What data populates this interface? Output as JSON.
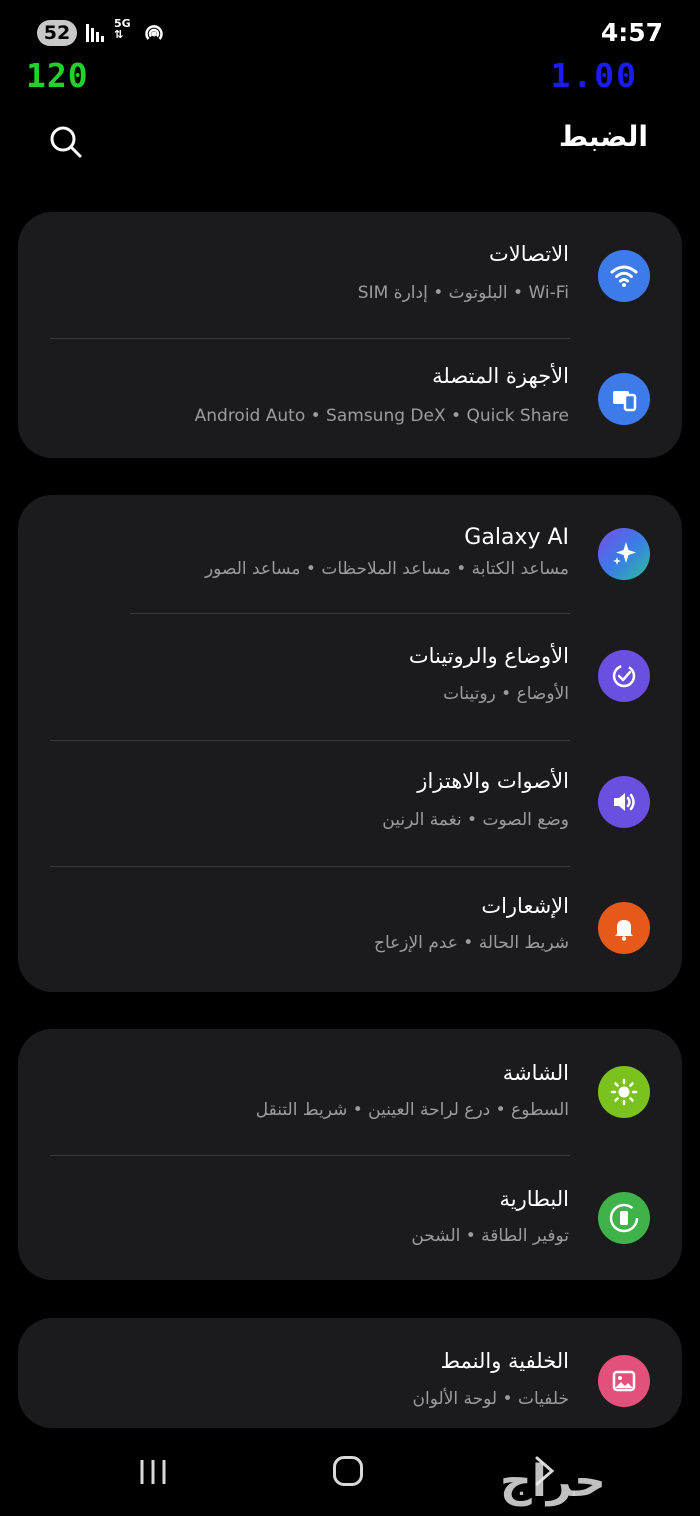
{
  "status_bar": {
    "badge": "52",
    "network": "5G",
    "time": "4:57"
  },
  "overlay": {
    "fps": "120",
    "frame_time": "1.00"
  },
  "header": {
    "title": "الضبط"
  },
  "groups": [
    {
      "items": [
        {
          "title": "الاتصالات",
          "subtitle": "Wi-Fi  •  البلوتوث  •  إدارة SIM",
          "icon": "wifi-icon",
          "color": "#3e7bea"
        },
        {
          "title": "الأجهزة المتصلة",
          "subtitle": "Android Auto  •  Samsung DeX  •  Quick Share",
          "icon": "connected-devices-icon",
          "color": "#3e7bea"
        }
      ]
    },
    {
      "items": [
        {
          "title": "Galaxy AI",
          "subtitle": "مساعد الكتابة  •  مساعد الملاحظات  •  مساعد الصور",
          "icon": "sparkle-icon",
          "color": "#4a6ee0"
        },
        {
          "title": "الأوضاع والروتينات",
          "subtitle": "الأوضاع  •  روتينات",
          "icon": "modes-icon",
          "color": "#6a4fe0"
        },
        {
          "title": "الأصوات والاهتزاز",
          "subtitle": "وضع الصوت  •  نغمة الرنين",
          "icon": "speaker-icon",
          "color": "#6a4fe0"
        },
        {
          "title": "الإشعارات",
          "subtitle": "شريط الحالة  •  عدم الإزعاج",
          "icon": "bell-icon",
          "color": "#e55a1a"
        }
      ]
    },
    {
      "items": [
        {
          "title": "الشاشة",
          "subtitle": "السطوع  •  درع لراحة العينين  •  شريط التنقل",
          "icon": "brightness-icon",
          "color": "#7cc21f"
        },
        {
          "title": "البطارية",
          "subtitle": "توفير الطاقة  •  الشحن",
          "icon": "battery-icon",
          "color": "#3fb24a"
        }
      ]
    },
    {
      "items": [
        {
          "title": "الخلفية والنمط",
          "subtitle": "خلفيات  •  لوحة الألوان",
          "icon": "wallpaper-icon",
          "color": "#e2517c"
        }
      ]
    }
  ],
  "watermark": "حراج"
}
